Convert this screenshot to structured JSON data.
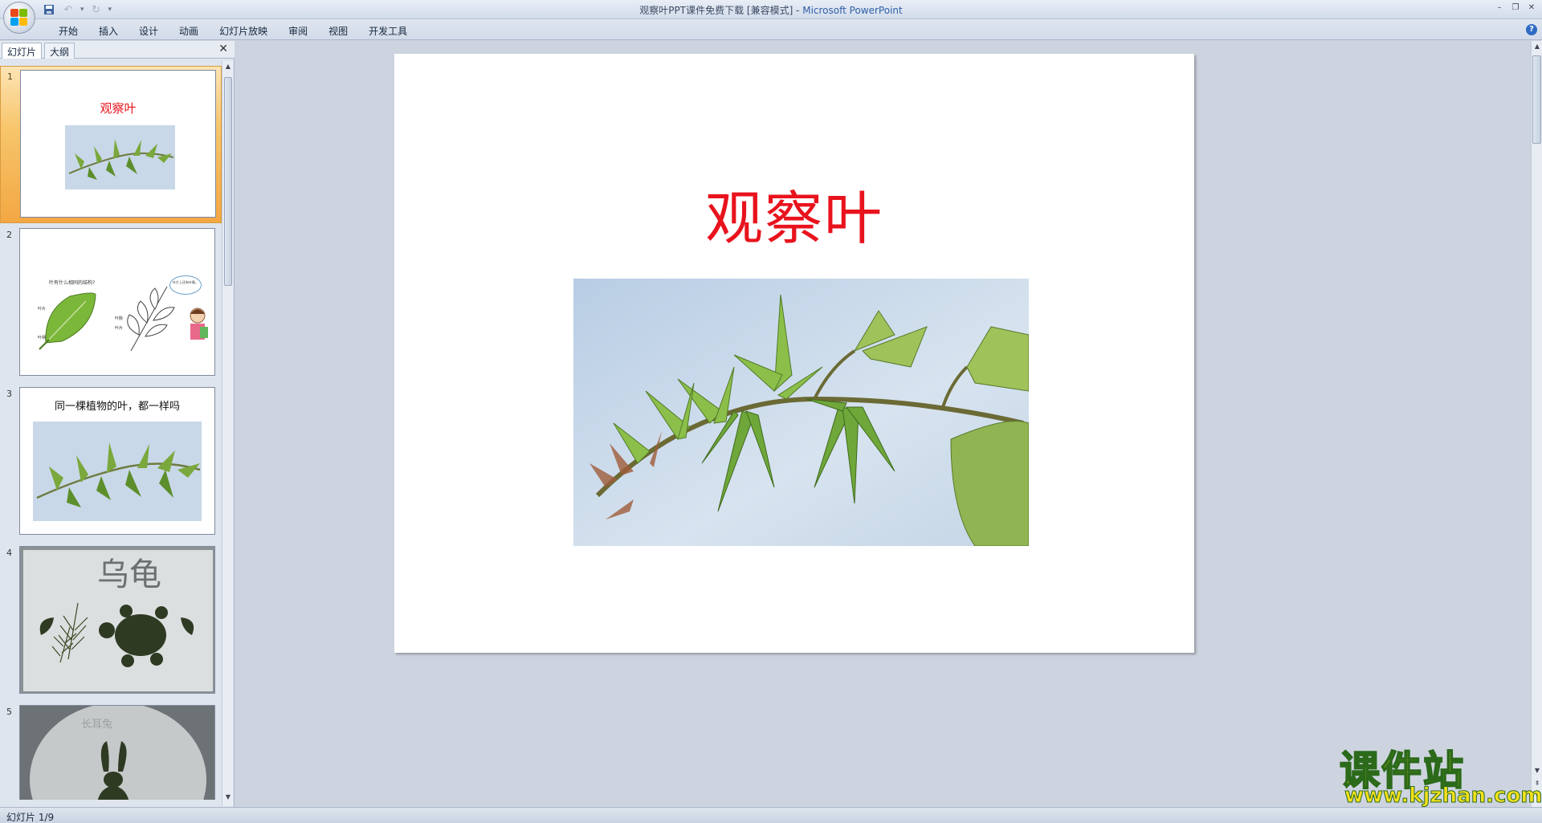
{
  "window": {
    "title": "观察叶PPT课件免费下载 [兼容模式] - ",
    "app_name": "Microsoft PowerPoint"
  },
  "quick_access": [
    {
      "icon": "save-icon"
    },
    {
      "icon": "undo-icon"
    },
    {
      "icon": "redo-icon"
    },
    {
      "icon": "customize-qat-icon"
    }
  ],
  "menu": {
    "tabs": [
      "开始",
      "插入",
      "设计",
      "动画",
      "幻灯片放映",
      "审阅",
      "视图",
      "开发工具"
    ]
  },
  "left_pane": {
    "tab_slides": "幻灯片",
    "tab_outline": "大纲",
    "thumbnails": [
      {
        "num": "1",
        "title": "观察叶"
      },
      {
        "num": "2",
        "question": "叶有什么相同的结构?",
        "bubble": "叶片上还有叶脉。",
        "label_blade": "叶片",
        "label_stalk": "叶柄",
        "label_vein": "叶脉",
        "label_blade2": "叶片"
      },
      {
        "num": "3",
        "title": "同一棵植物的叶，都一样吗"
      },
      {
        "num": "4",
        "text": "乌龟"
      },
      {
        "num": "5",
        "text": "长耳兔"
      }
    ]
  },
  "slide": {
    "title": "观察叶"
  },
  "status": {
    "slide_position": "幻灯片 1/9"
  },
  "watermark": {
    "text": "课件站",
    "url": "www.kjzhan.com"
  },
  "colors": {
    "slide_title": "#e8131d",
    "selection": "#f7c56b"
  }
}
